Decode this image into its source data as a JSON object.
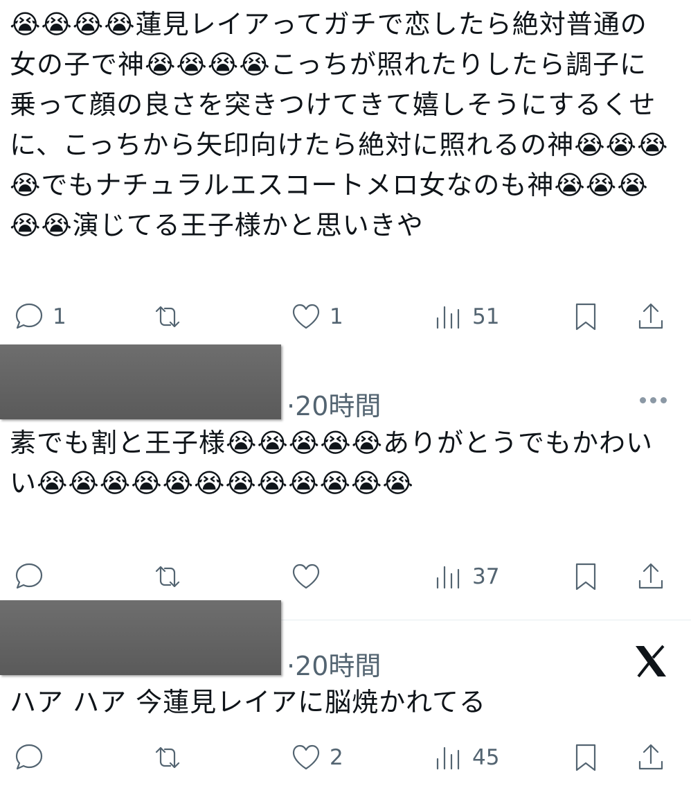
{
  "tweets": [
    {
      "text": "😭😭😭😭蓮見レイアってガチで恋したら絶対普通の女の子で神😭😭😭😭こっちが照れたりしたら調子に乗って顔の良さを突きつけてきて嬉しそうにするくせに、こっちから矢印向けたら絶対に照れるの神😭😭😭😭でもナチュラルエスコートメロ女なのも神😭😭😭😭😭演じてる王子様かと思いきや",
      "reply_count": "1",
      "retweet_count": "",
      "like_count": "1",
      "view_count": "51"
    },
    {
      "time": "·20時間",
      "text": "素でも割と王子様😭😭😭😭😭ありがとうでもかわいい😭😭😭😭😭😭😭😭😭😭😭😭",
      "reply_count": "",
      "retweet_count": "",
      "like_count": "",
      "view_count": "37"
    },
    {
      "time": "·20時間",
      "text": "ハア ハア 今蓮見レイアに脳焼かれてる",
      "reply_count": "",
      "retweet_count": "",
      "like_count": "2",
      "view_count": "45"
    }
  ],
  "colors": {
    "icon": "#536471",
    "text": "#0f1419",
    "redaction": "#5f5f5f"
  },
  "icons": [
    "reply-icon",
    "retweet-icon",
    "like-icon",
    "views-icon",
    "bookmark-icon",
    "share-icon",
    "more-icon",
    "x-logo-icon"
  ]
}
